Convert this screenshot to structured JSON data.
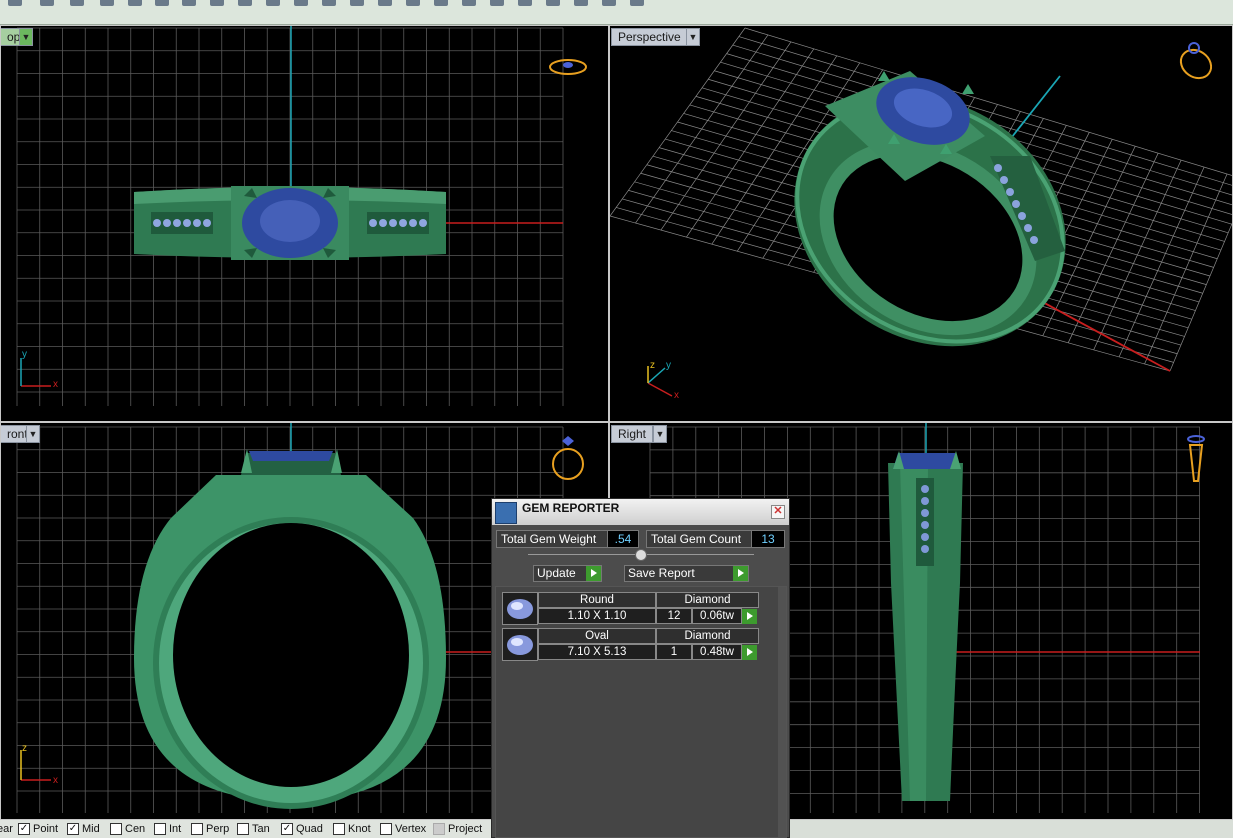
{
  "viewports": {
    "top": {
      "label": "op",
      "dropdown": "▼"
    },
    "perspective": {
      "label": "Perspective",
      "dropdown": "▼"
    },
    "front": {
      "label": "ront",
      "dropdown": "▼"
    },
    "right": {
      "label": "Right",
      "dropdown": "▼"
    }
  },
  "axes": {
    "x": "x",
    "y": "y",
    "z": "z"
  },
  "colors": {
    "metal": "#2f7a52",
    "metal_light": "#5ab487",
    "gem_blue": "#2e4aa0",
    "grid": "#5a5a5a",
    "axis_red": "#c81e1e",
    "axis_cyan": "#1aa6b5"
  },
  "gem_reporter": {
    "title": "GEM REPORTER",
    "close_icon": "close-icon",
    "total_weight_label": "Total Gem Weight",
    "total_weight_value": ".54",
    "total_count_label": "Total Gem Count",
    "total_count_value": "13",
    "update_label": "Update",
    "save_report_label": "Save Report",
    "gems": [
      {
        "shape": "Round",
        "size": "1.10 X 1.10",
        "material": "Diamond",
        "count": "12",
        "weight": "0.06tw"
      },
      {
        "shape": "Oval",
        "size": "7.10 X 5.13",
        "material": "Diamond",
        "count": "1",
        "weight": "0.48tw"
      }
    ]
  },
  "snap_bar": {
    "items": [
      {
        "label": "ear",
        "checked": null
      },
      {
        "label": "Point",
        "checked": true
      },
      {
        "label": "Mid",
        "checked": true
      },
      {
        "label": "Cen",
        "checked": false
      },
      {
        "label": "Int",
        "checked": false
      },
      {
        "label": "Perp",
        "checked": false
      },
      {
        "label": "Tan",
        "checked": false
      },
      {
        "label": "Quad",
        "checked": true
      },
      {
        "label": "Knot",
        "checked": false
      },
      {
        "label": "Vertex",
        "checked": false
      },
      {
        "label": "Project",
        "checked": false
      }
    ]
  }
}
